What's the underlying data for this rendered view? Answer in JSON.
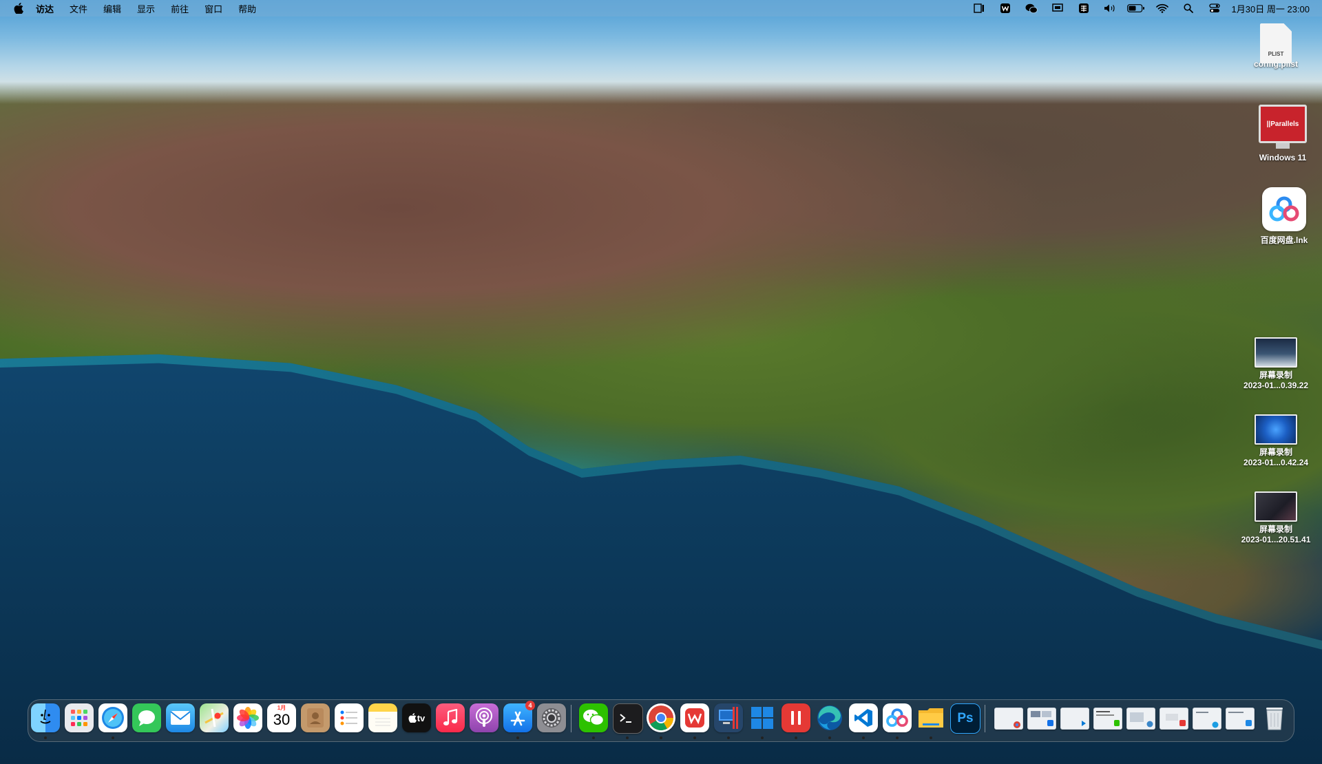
{
  "menubar": {
    "app_name": "访达",
    "menus": [
      "文件",
      "编辑",
      "显示",
      "前往",
      "窗口",
      "帮助"
    ],
    "clock": "1月30日 周一 23:00"
  },
  "desktop": {
    "icons": [
      {
        "name": "config-plist",
        "label": "config.plist",
        "badge": "PLIST"
      },
      {
        "name": "windows-11",
        "label": "Windows 11",
        "badge": "||Parallels"
      },
      {
        "name": "baidu-netdisk",
        "label": "百度网盘.lnk"
      },
      {
        "name": "screen-recording-1",
        "label_line1": "屏幕录制",
        "label_line2": "2023-01...0.39.22"
      },
      {
        "name": "screen-recording-2",
        "label_line1": "屏幕录制",
        "label_line2": "2023-01...0.42.24"
      },
      {
        "name": "screen-recording-3",
        "label_line1": "屏幕录制",
        "label_line2": "2023-01...20.51.41"
      }
    ]
  },
  "dock": {
    "calendar": {
      "month": "1月",
      "day": "30"
    },
    "tv_label": "tv",
    "appstore_badge": "4",
    "ps_label": "Ps",
    "colors": {
      "finder": "#2f8cf0",
      "messages": "#34c759",
      "mail": "#1e88e5",
      "music": "#fa3c4c",
      "podcasts": "#9b4dde",
      "wps": "#e53935",
      "ps_bg": "#001e36",
      "ps_fg": "#31a8ff"
    }
  }
}
